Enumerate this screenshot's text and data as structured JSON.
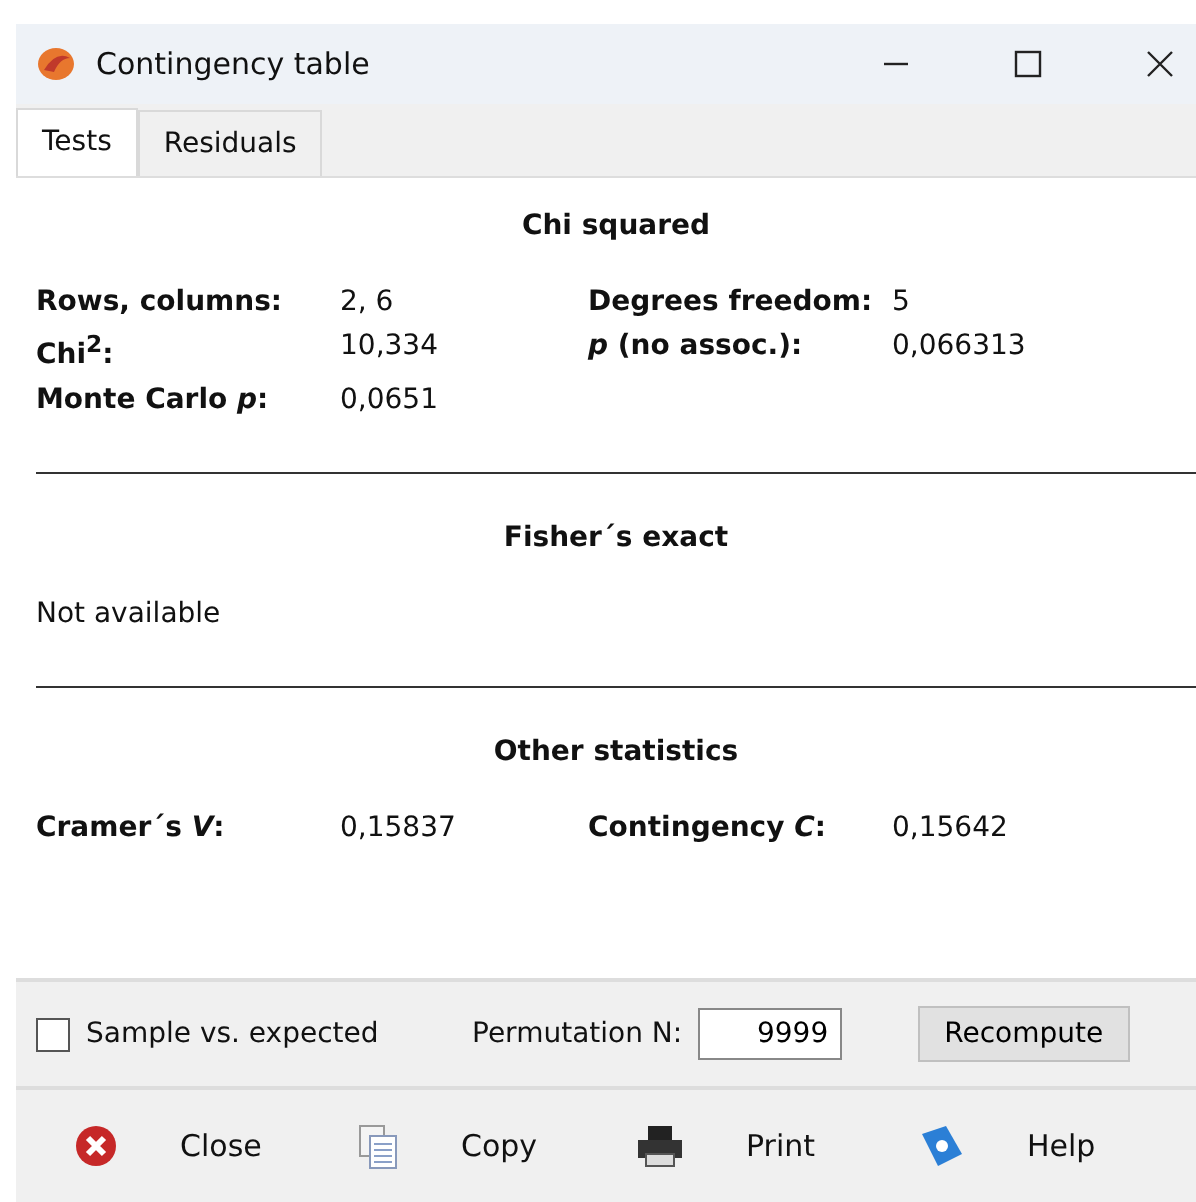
{
  "window": {
    "title": "Contingency table"
  },
  "tabs": [
    {
      "label": "Tests",
      "selected": true
    },
    {
      "label": "Residuals",
      "selected": false
    }
  ],
  "sections": [
    {
      "title": "Chi squared",
      "stats": [
        {
          "label": "Rows, columns:",
          "value": "2, 6"
        },
        {
          "label": "Degrees freedom:",
          "value": "5"
        },
        {
          "label": "Chi$^{2}$:",
          "value": "10,334"
        },
        {
          "label": "*p* (no assoc.):",
          "value": "0,066313"
        },
        {
          "label": "Monte Carlo *p*:",
          "value": "0,0651"
        }
      ]
    },
    {
      "title": "Fisher´s exact",
      "note": "Not available"
    },
    {
      "title": "Other statistics",
      "stats": [
        {
          "label": "Cramer´s *V*:",
          "value": "0,15837"
        },
        {
          "label": "Contingency *C*:",
          "value": "0,15642"
        }
      ]
    }
  ],
  "options": {
    "checkbox": {
      "label": "Sample vs. expected",
      "checked": false
    },
    "permutation": {
      "label": "Permutation N:",
      "value": "9999"
    },
    "button": "Recompute"
  },
  "actions": [
    {
      "kind": "close",
      "label": "Close"
    },
    {
      "kind": "copy",
      "label": "Copy"
    },
    {
      "kind": "print",
      "label": "Print"
    },
    {
      "kind": "help",
      "label": "Help"
    }
  ]
}
